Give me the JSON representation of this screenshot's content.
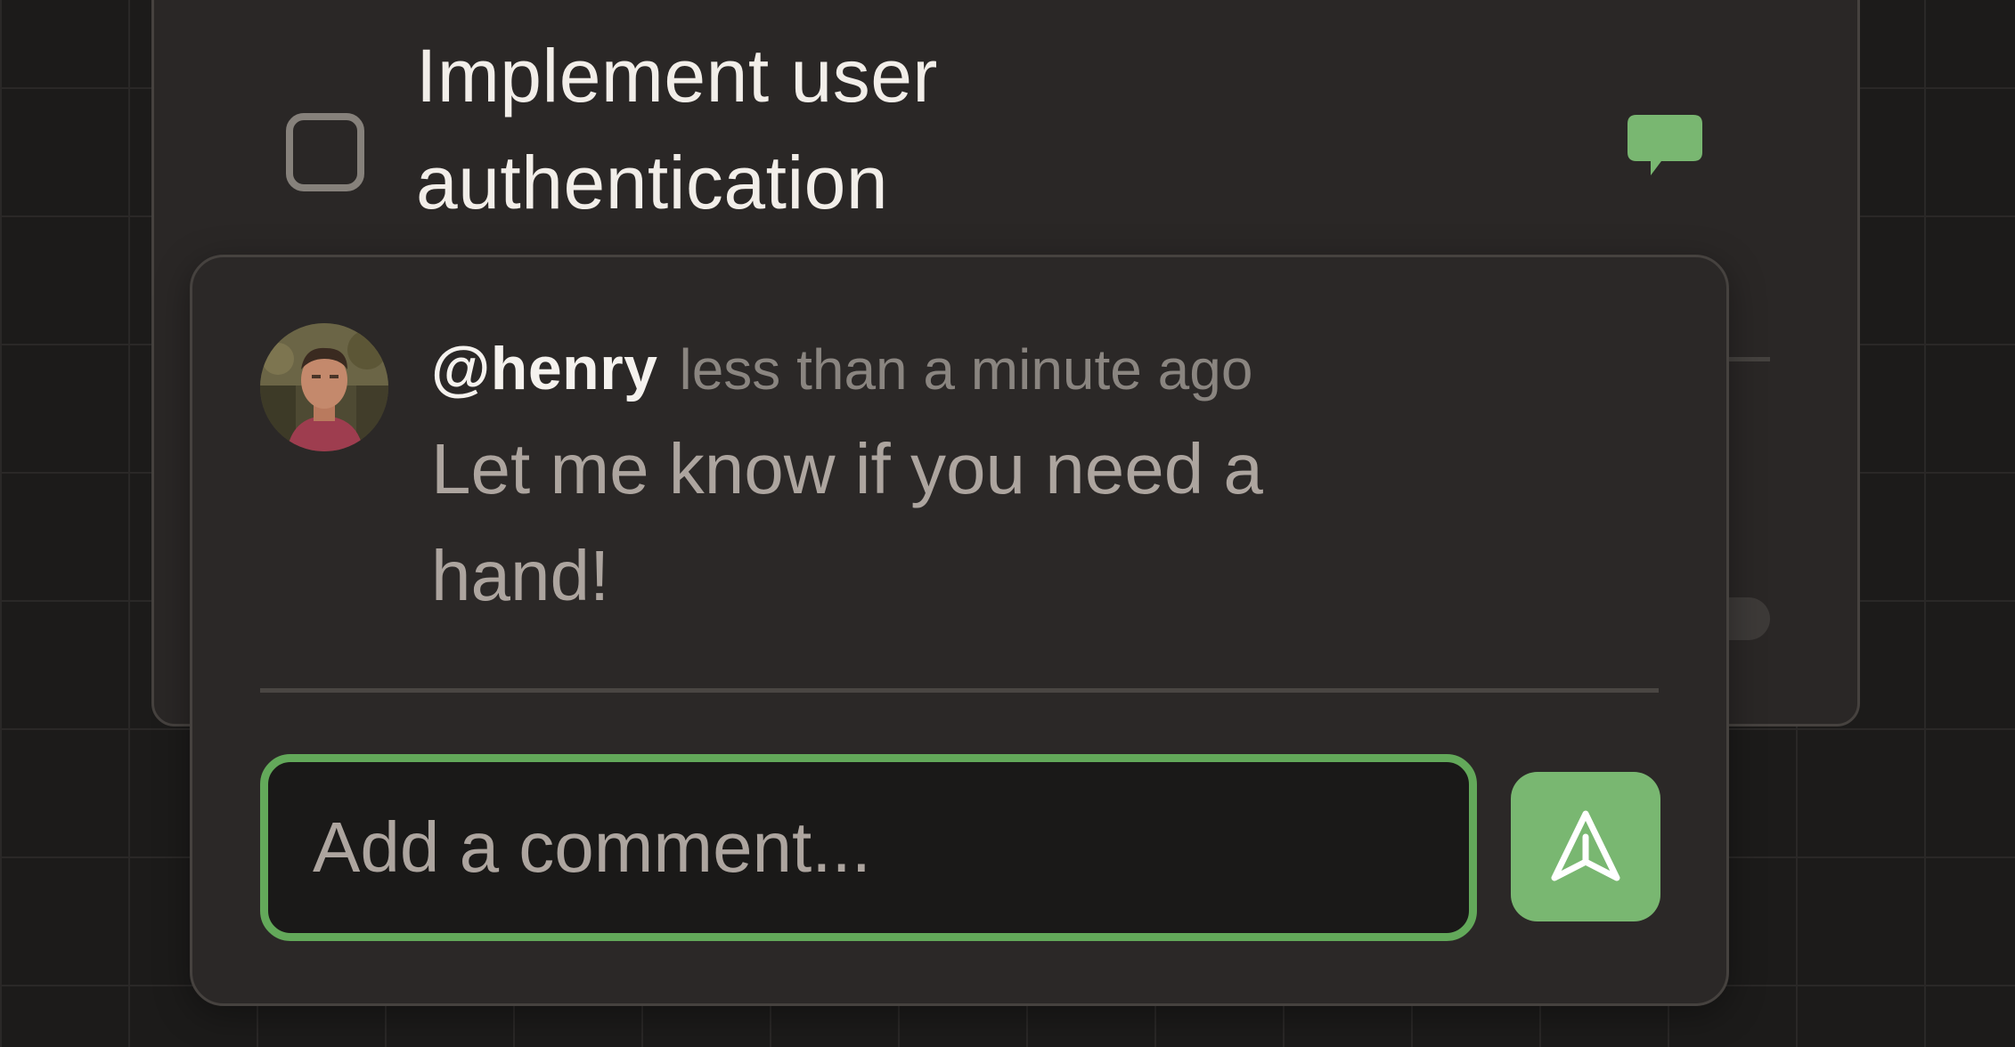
{
  "task": {
    "title": "Implement user authentication",
    "checked": false,
    "comment_icon": "speech-bubble-icon"
  },
  "comments": [
    {
      "author": "@henry",
      "time": "less than a minute ago",
      "text": "Let me know if you need a hand!"
    }
  ],
  "composer": {
    "placeholder": "Add a comment...",
    "value": "",
    "send_icon": "send-arrow-icon"
  },
  "colors": {
    "accent": "#79b771",
    "focus_border": "#63a95a",
    "card_background": "#2a2726",
    "page_background": "#1c1b1a"
  }
}
